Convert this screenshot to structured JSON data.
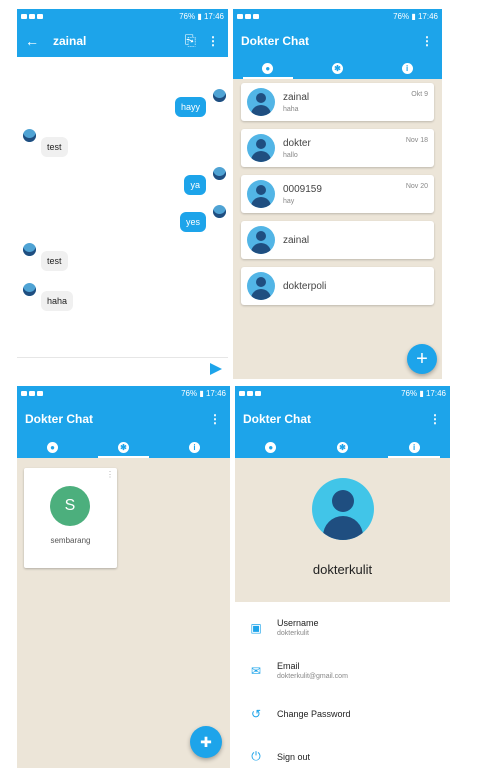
{
  "status": {
    "battery": "76%",
    "time": "17:46"
  },
  "chat_screen": {
    "title": "zainal",
    "messages": [
      {
        "dir": "out",
        "text": "hayy"
      },
      {
        "dir": "in",
        "text": "test"
      },
      {
        "dir": "out",
        "text": "ya"
      },
      {
        "dir": "out",
        "text": "yes"
      },
      {
        "dir": "in",
        "text": "test"
      },
      {
        "dir": "in",
        "text": "haha"
      }
    ]
  },
  "app_title": "Dokter Chat",
  "tabs": [
    {
      "icon": "person-icon"
    },
    {
      "icon": "group-icon"
    },
    {
      "icon": "info-icon"
    }
  ],
  "chat_list": [
    {
      "name": "zainal",
      "last": "haha",
      "date": "Okt 9"
    },
    {
      "name": "dokter",
      "last": "hallo",
      "date": "Nov 18"
    },
    {
      "name": "0009159",
      "last": "hay",
      "date": "Nov 20"
    },
    {
      "name": "zainal",
      "last": "",
      "date": ""
    },
    {
      "name": "dokterpoli",
      "last": "",
      "date": ""
    }
  ],
  "groups": [
    {
      "initial": "S",
      "name": "sembarang",
      "color": "#4caf7d"
    }
  ],
  "profile": {
    "name": "dokterkulit",
    "username_label": "Username",
    "username": "dokterkulit",
    "email_label": "Email",
    "email": "dokterkulit@gmail.com",
    "change_password": "Change Password",
    "sign_out": "Sign out"
  },
  "colors": {
    "accent": "#1da4ea",
    "background": "#ece5d8"
  }
}
